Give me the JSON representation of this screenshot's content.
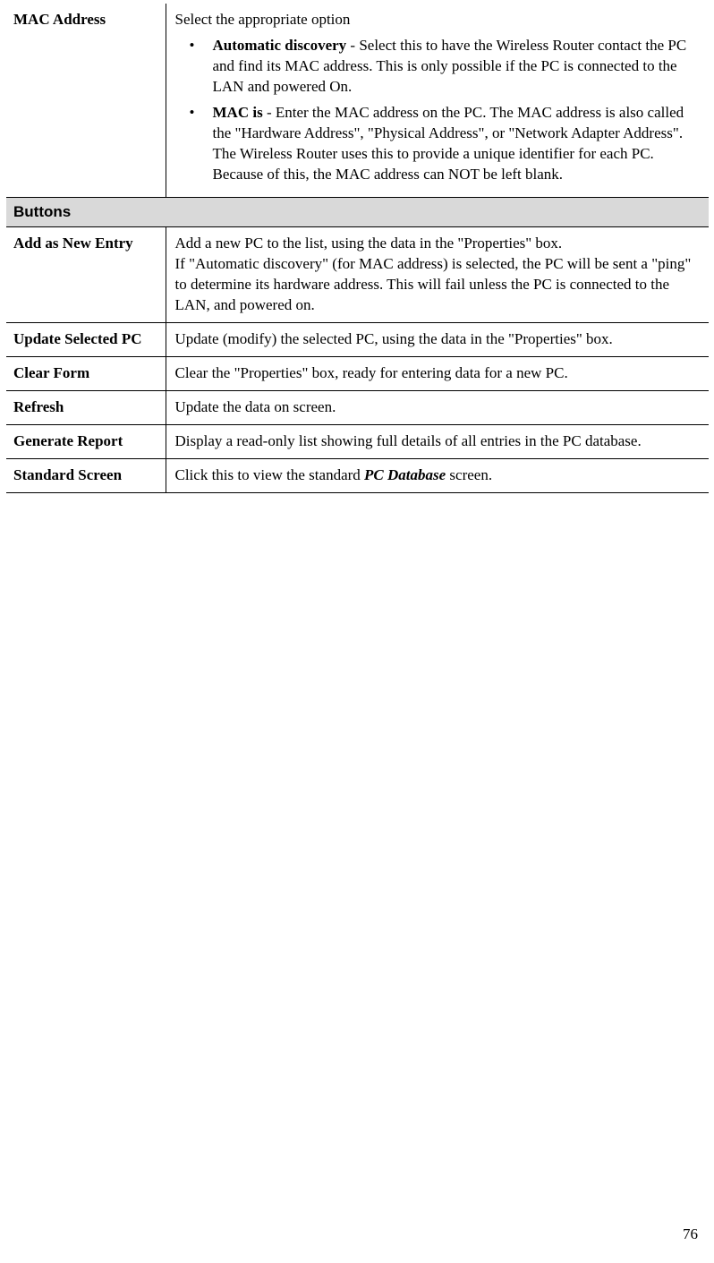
{
  "rows": {
    "mac_address": {
      "label": "MAC Address",
      "intro": "Select the appropriate option",
      "bullet1_bold": "Automatic discovery",
      "bullet1_rest": " - Select this to have the Wireless Router contact the PC and find its MAC address. This is only possible if the PC is connected to the LAN and powered On.",
      "bullet2_bold": "MAC is",
      "bullet2_rest": " - Enter the MAC address on the PC. The MAC address is also called the \"Hardware Address\", \"Physical Address\", or \"Network Adapter Address\". The Wireless Router uses this to provide a unique identifier for each PC. Because of this, the MAC address can NOT be left blank."
    },
    "buttons_header": "Buttons",
    "add_as_new": {
      "label": "Add as New Entry",
      "line1": "Add a new PC to the list, using the data in the \"Properties\" box.",
      "line2": "If \"Automatic discovery\" (for MAC address) is selected, the PC will be sent a \"ping\" to determine its hardware address. This will fail unless the PC is connected to the LAN, and powered on."
    },
    "update_selected": {
      "label": "Update Selected PC",
      "desc": "Update (modify) the selected PC, using the data in the \"Properties\" box."
    },
    "clear_form": {
      "label": "Clear Form",
      "desc": "Clear the \"Properties\" box, ready for entering data for a new PC."
    },
    "refresh": {
      "label": "Refresh",
      "desc": "Update the data on screen."
    },
    "generate_report": {
      "label": "Generate Report",
      "desc": "Display a read-only list showing full details of all entries in the PC database."
    },
    "standard_screen": {
      "label": "Standard Screen",
      "pre": "Click this to view the standard ",
      "em": "PC Database",
      "post": " screen."
    }
  },
  "page_number": "76"
}
